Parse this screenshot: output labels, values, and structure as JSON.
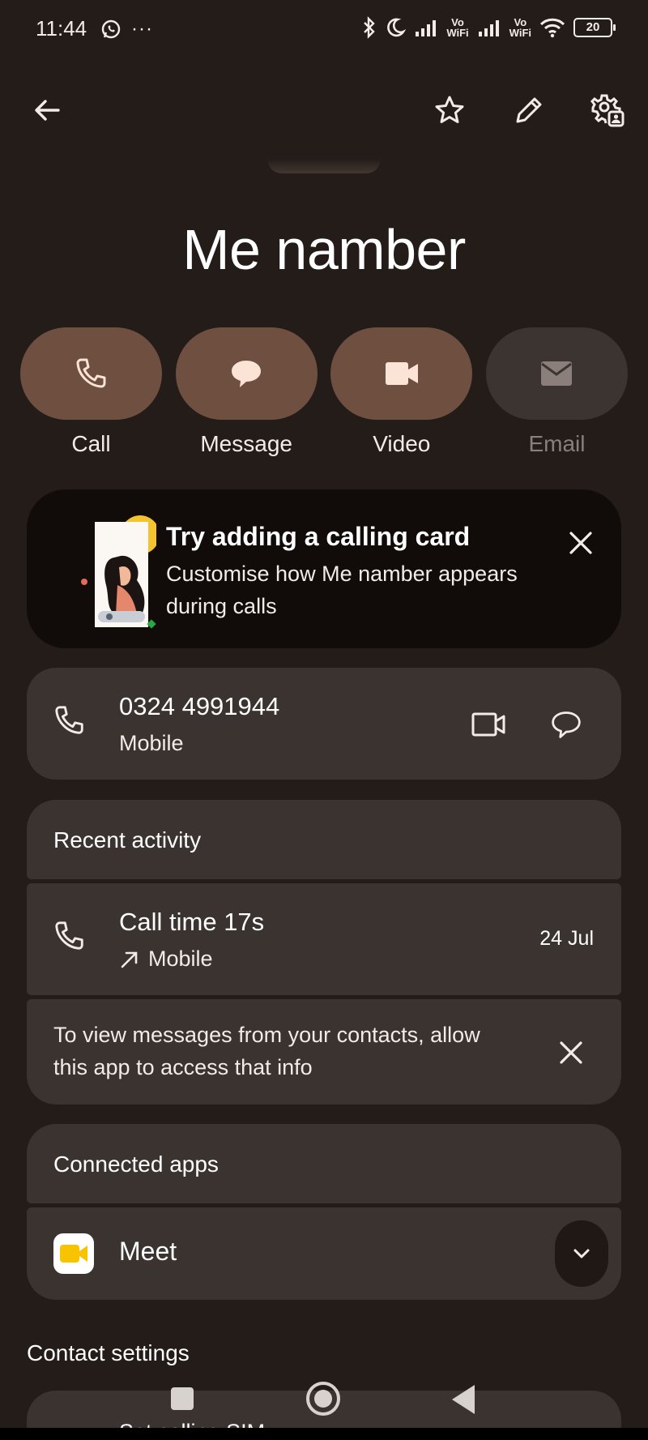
{
  "status_bar": {
    "time": "11:44",
    "overflow": "···",
    "vo_wifi_1": "Vo\nWiFi",
    "vo_wifi_2": "Vo\nWiFi",
    "battery": "20"
  },
  "contact": {
    "name": "Me namber"
  },
  "actions": [
    {
      "label": "Call",
      "icon": "phone-icon",
      "enabled": true
    },
    {
      "label": "Message",
      "icon": "message-icon",
      "enabled": true
    },
    {
      "label": "Video",
      "icon": "video-icon",
      "enabled": true
    },
    {
      "label": "Email",
      "icon": "email-icon",
      "enabled": false
    }
  ],
  "banner": {
    "title": "Try adding a calling card",
    "subtitle": "Customise how Me namber appears during calls"
  },
  "phone": {
    "number": "0324 4991944",
    "type": "Mobile"
  },
  "recent": {
    "title": "Recent activity",
    "call_title": "Call time 17s",
    "call_type": "Mobile",
    "call_date": "24 Jul",
    "permission_text": "To view messages from your contacts, allow this app to access that info"
  },
  "connected_apps": {
    "title": "Connected apps",
    "meet_label": "Meet"
  },
  "contact_settings": {
    "title": "Contact settings",
    "peek_text": "Set calling SIM"
  },
  "colors": {
    "background": "#231c19",
    "action_pill": "#6e4f40",
    "card": "#3a3330",
    "banner": "#110c0a",
    "meet_yellow": "#f8c300"
  }
}
